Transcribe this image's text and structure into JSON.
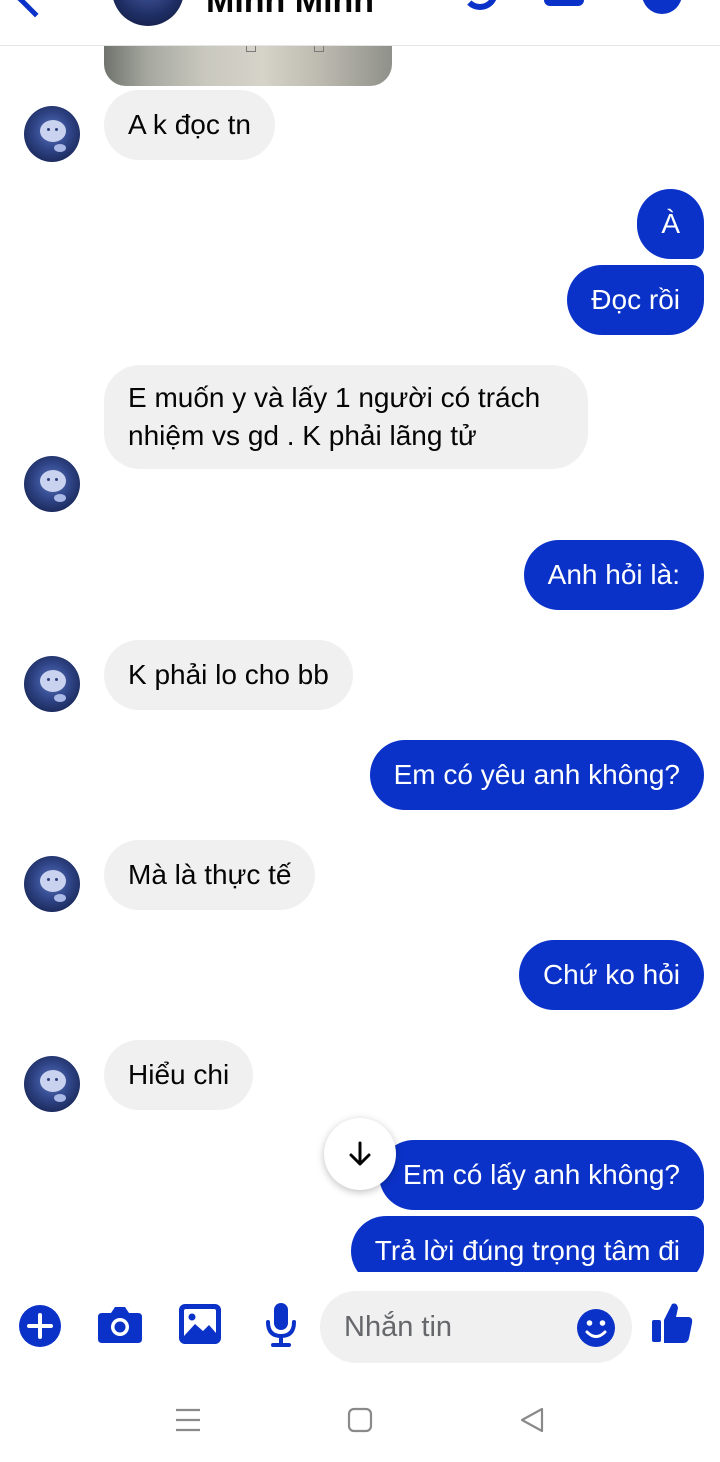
{
  "header": {
    "contact_name": "Minh Minh",
    "icons": [
      "back-arrow-icon",
      "phone-icon",
      "video-icon",
      "info-icon"
    ]
  },
  "messages": [
    {
      "side": "in",
      "text": "A k đọc tn"
    },
    {
      "side": "out",
      "text": "À"
    },
    {
      "side": "out",
      "text": "Đọc rồi"
    },
    {
      "side": "in",
      "text": "E muốn y và lấy 1 người có trách nhiệm vs gd . K phải lãng tử"
    },
    {
      "side": "out",
      "text": "Anh hỏi là:"
    },
    {
      "side": "in",
      "text": "K phải lo cho bb"
    },
    {
      "side": "out",
      "text": "Em có yêu anh không?"
    },
    {
      "side": "in",
      "text": "Mà là thực tế"
    },
    {
      "side": "out",
      "text": "Chứ ko hỏi"
    },
    {
      "side": "in",
      "text": "Hiểu chi"
    },
    {
      "side": "out",
      "text": "Em có lấy anh không?"
    },
    {
      "side": "out",
      "text": "Trả lời đúng trọng tâm đi"
    }
  ],
  "composer": {
    "placeholder": "Nhắn tin",
    "icons": [
      "plus-icon",
      "camera-icon",
      "image-icon",
      "microphone-icon",
      "emoji-icon",
      "like-icon"
    ]
  },
  "colors": {
    "accent": "#0a32c8",
    "incoming_bubble": "#f0f0f0",
    "outgoing_text": "#ffffff"
  }
}
